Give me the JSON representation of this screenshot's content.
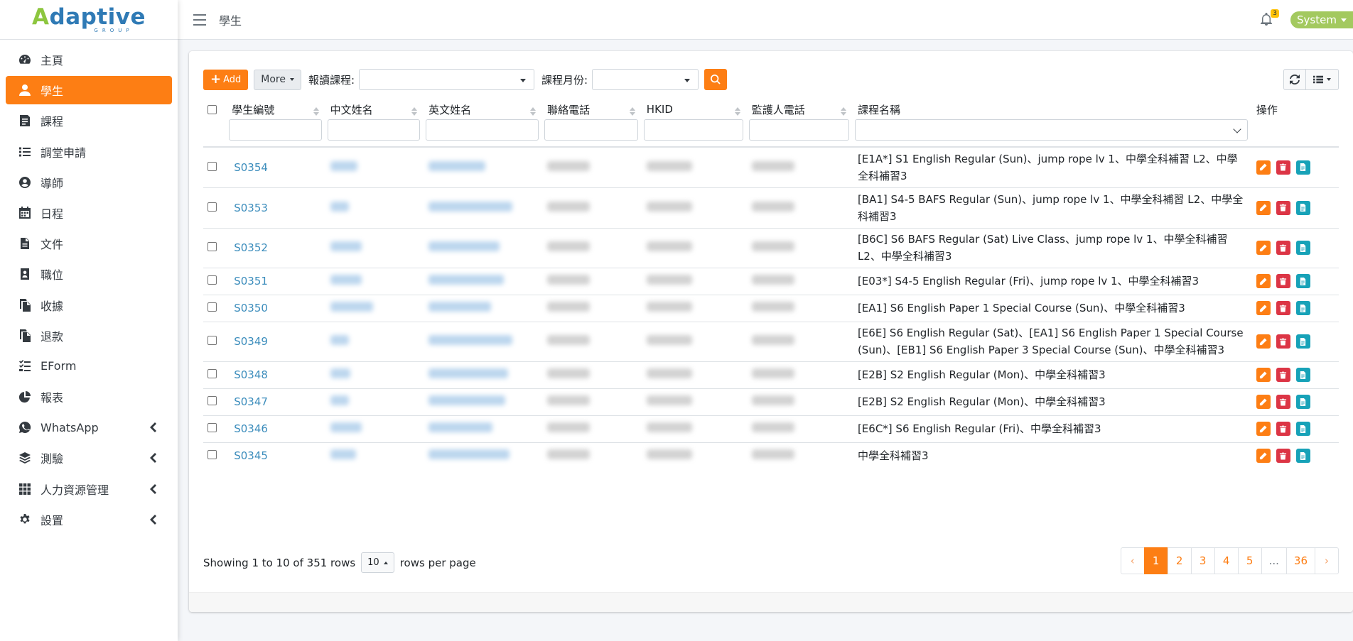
{
  "brand": {
    "logo_first": "A",
    "logo_rest": "daptive",
    "sub": "GROUP"
  },
  "sidebar": {
    "items": [
      {
        "label": "主頁",
        "icon": "dashboard-icon",
        "active": false
      },
      {
        "label": "學生",
        "icon": "user-icon",
        "active": true
      },
      {
        "label": "課程",
        "icon": "book-icon",
        "active": false
      },
      {
        "label": "調堂申請",
        "icon": "list-icon",
        "active": false
      },
      {
        "label": "導師",
        "icon": "user-circle-icon",
        "active": false
      },
      {
        "label": "日程",
        "icon": "calendar-icon",
        "active": false
      },
      {
        "label": "文件",
        "icon": "file-icon",
        "active": false
      },
      {
        "label": "職位",
        "icon": "id-badge-icon",
        "active": false
      },
      {
        "label": "收據",
        "icon": "copy-icon",
        "active": false
      },
      {
        "label": "退款",
        "icon": "copy-icon",
        "active": false
      },
      {
        "label": "EForm",
        "icon": "tasks-icon",
        "active": false
      },
      {
        "label": "報表",
        "icon": "pie-chart-icon",
        "active": false
      },
      {
        "label": "WhatsApp",
        "icon": "whatsapp-icon",
        "active": false,
        "expandable": true
      },
      {
        "label": "測驗",
        "icon": "layers-icon",
        "active": false,
        "expandable": true
      },
      {
        "label": "人力資源管理",
        "icon": "grid-icon",
        "active": false,
        "expandable": true
      },
      {
        "label": "設置",
        "icon": "gear-icon",
        "active": false,
        "expandable": true
      }
    ]
  },
  "header": {
    "title": "學生",
    "notifications": "3",
    "user": "System"
  },
  "toolbar": {
    "add_label": "Add",
    "more_label": "More",
    "course_filter_label": "報讀課程:",
    "month_filter_label": "課程月份:"
  },
  "table": {
    "columns": [
      "學生編號",
      "中文姓名",
      "英文姓名",
      "聯絡電話",
      "HKID",
      "監護人電話",
      "課程名稱",
      "操作"
    ],
    "rows": [
      {
        "id": "S0354",
        "course": "[E1A*] S1 English Regular (Sun)、jump rope lv 1、中學全科補習 L2、中學全科補習3"
      },
      {
        "id": "S0353",
        "course": "[BA1] S4-5 BAFS Regular (Sun)、jump rope lv 1、中學全科補習 L2、中學全科補習3"
      },
      {
        "id": "S0352",
        "course": "[B6C] S6 BAFS Regular (Sat) Live Class、jump rope lv 1、中學全科補習 L2、中學全科補習3"
      },
      {
        "id": "S0351",
        "course": "[E03*] S4-5 English Regular (Fri)、jump rope lv 1、中學全科補習3"
      },
      {
        "id": "S0350",
        "course": "[EA1] S6 English Paper 1 Special Course (Sun)、中學全科補習3"
      },
      {
        "id": "S0349",
        "course": "[E6E] S6 English Regular (Sat)、[EA1] S6 English Paper 1 Special Course (Sun)、[EB1] S6 English Paper 3 Special Course (Sun)、中學全科補習3"
      },
      {
        "id": "S0348",
        "course": "[E2B] S2 English Regular (Mon)、中學全科補習3"
      },
      {
        "id": "S0347",
        "course": "[E2B] S2 English Regular (Mon)、中學全科補習3"
      },
      {
        "id": "S0346",
        "course": "[E6C*] S6 English Regular (Fri)、中學全科補習3"
      },
      {
        "id": "S0345",
        "course": "中學全科補習3"
      }
    ]
  },
  "footer": {
    "showing": "Showing 1 to 10 of 351 rows",
    "per_page": "10",
    "per_page_suffix": "rows per page",
    "pages": [
      "‹",
      "1",
      "2",
      "3",
      "4",
      "5",
      "...",
      "36",
      "›"
    ],
    "current_page": "1"
  },
  "colors": {
    "accent": "#fd7e14",
    "link": "#3c8dbc",
    "danger": "#dc3545",
    "info": "#17a2b8",
    "user_pill": "#a3c95f"
  }
}
